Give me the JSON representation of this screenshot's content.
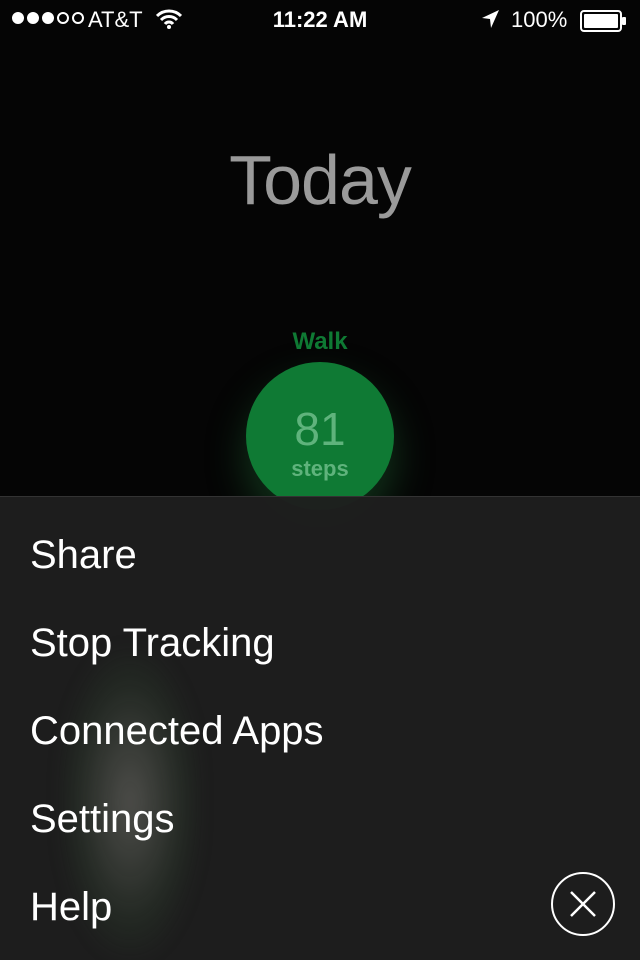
{
  "status_bar": {
    "carrier": "AT&T",
    "time": "11:22 AM",
    "battery": "100%",
    "signal_bars_filled": 3,
    "signal_bars_total": 5
  },
  "page": {
    "title": "Today",
    "activity": {
      "label": "Walk",
      "count": "81",
      "unit": "steps",
      "color": "#0f7a34"
    }
  },
  "menu": {
    "items": [
      {
        "label": "Share"
      },
      {
        "label": "Stop Tracking"
      },
      {
        "label": "Connected Apps"
      },
      {
        "label": "Settings"
      },
      {
        "label": "Help"
      }
    ],
    "close_icon": "close-x-icon"
  }
}
